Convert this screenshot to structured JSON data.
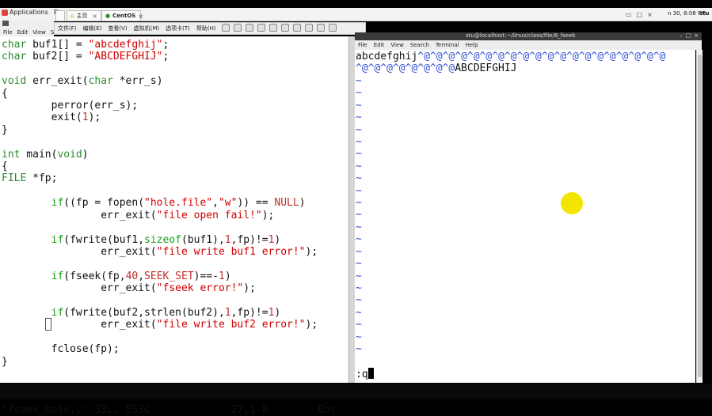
{
  "topbar": {
    "applications": "Applications",
    "places_cut": "Pl",
    "clock": "n 30, 8:08 PM",
    "user": "stu"
  },
  "tabs": [
    {
      "label": "主页"
    },
    {
      "label": "CentOS"
    }
  ],
  "vm_menu": [
    "文件(F)",
    "编辑(E)",
    "查看(V)",
    "虚拟机(M)",
    "选项卡(T)",
    "帮助(H)"
  ],
  "left_menu": [
    "File",
    "Edit",
    "View",
    "Se"
  ],
  "editor": {
    "lines": [
      "char buf1[] = \"abcdefghij\";",
      "char buf2[] = \"ABCDEFGHIJ\";",
      "",
      "void err_exit(char *err_s)",
      "{",
      "        perror(err_s);",
      "        exit(1);",
      "}",
      "",
      "int main(void)",
      "{",
      "FILE *fp;",
      "",
      "        if((fp = fopen(\"hole.file\",\"w\")) == NULL)",
      "                err_exit(\"file open fail!\");",
      "",
      "        if(fwrite(buf1,sizeof(buf1),1,fp)!=1)",
      "                err_exit(\"file write buf1 error!\");",
      "",
      "        if(fseek(fp,40,SEEK_SET)==-1)",
      "                err_exit(\"fseek error!\");",
      "",
      "        if(fwrite(buf2,strlen(buf2),1,fp)!=1)",
      "                err_exit(\"file write buf2 error!\");",
      "",
      "        fclose(fp);",
      "}"
    ],
    "status_file": "\"fseek_hole.c\" 33L, 553C",
    "status_pos": "27,1-8",
    "status_scroll": "Bot"
  },
  "terminal": {
    "title": "stu@localhost:~/linux/class/file/8_fseek",
    "menu": [
      "File",
      "Edit",
      "View",
      "Search",
      "Terminal",
      "Help"
    ],
    "line1_plain": "abcdefghij",
    "line1_ctrl": "^@^@^@^@^@^@^@^@^@^@^@^@^@^@^@^@^@^@^@^@",
    "line2_ctrl": "^@^@^@^@^@^@^@^@",
    "line2_plain": "ABCDEFGHIJ",
    "tilde_count": 23,
    "command": ":q"
  },
  "colors": {
    "keyword": "#1c9a1c",
    "string": "#d10000",
    "vim_blue": "#2f4fd1",
    "pointer_highlight": "#f2e600"
  }
}
